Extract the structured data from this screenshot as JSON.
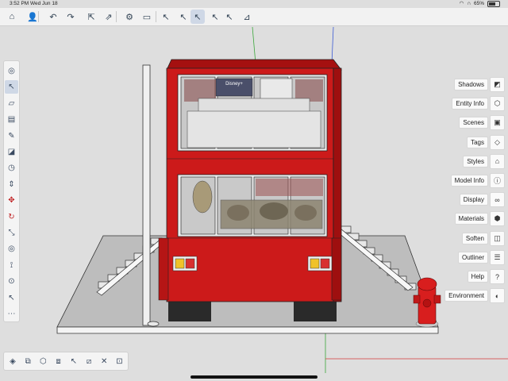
{
  "status": {
    "time": "3:52 PM",
    "date": "Wed Jun 18",
    "battery": "65%",
    "battery_level": 0.65
  },
  "toolbar": {
    "items": [
      {
        "name": "home-icon",
        "glyph": "⌂"
      },
      {
        "name": "account-icon",
        "glyph": "👤"
      },
      {
        "name": "undo-icon",
        "glyph": "↶"
      },
      {
        "name": "redo-icon",
        "glyph": "↷"
      },
      {
        "name": "import-icon",
        "glyph": "⇱"
      },
      {
        "name": "export-icon",
        "glyph": "⇗"
      },
      {
        "name": "settings-icon",
        "glyph": "⚙"
      },
      {
        "name": "view-icon",
        "glyph": "▭"
      },
      {
        "name": "select-plus-icon",
        "glyph": "↖"
      },
      {
        "name": "select-minus-icon",
        "glyph": "↖"
      },
      {
        "name": "select-icon",
        "glyph": "↖"
      },
      {
        "name": "select-toggle-icon",
        "glyph": "↖"
      },
      {
        "name": "select-visible-icon",
        "glyph": "↖"
      },
      {
        "name": "xray-icon",
        "glyph": "⊿"
      }
    ]
  },
  "left_tools": [
    {
      "name": "orbit-icon",
      "glyph": "◎"
    },
    {
      "name": "select-tool-icon",
      "glyph": "↖",
      "active": true
    },
    {
      "name": "eraser-icon",
      "glyph": "▱"
    },
    {
      "name": "paint-bucket-icon",
      "glyph": "▤"
    },
    {
      "name": "pencil-icon",
      "glyph": "✎"
    },
    {
      "name": "rectangle-icon",
      "glyph": "◪"
    },
    {
      "name": "circle-icon",
      "glyph": "◷"
    },
    {
      "name": "push-pull-icon",
      "glyph": "⇕"
    },
    {
      "name": "move-icon",
      "glyph": "✥",
      "red": true
    },
    {
      "name": "rotate-icon",
      "glyph": "↻",
      "red": true
    },
    {
      "name": "scale-icon",
      "glyph": "⤡"
    },
    {
      "name": "offset-icon",
      "glyph": "◎"
    },
    {
      "name": "tape-measure-icon",
      "glyph": "⟟"
    },
    {
      "name": "text-tool-icon",
      "glyph": "⊙"
    },
    {
      "name": "pointer-icon",
      "glyph": "↖"
    },
    {
      "name": "more-icon",
      "glyph": "⋯"
    }
  ],
  "bottom_tools": [
    {
      "name": "component-icon",
      "glyph": "◈"
    },
    {
      "name": "group-icon",
      "glyph": "⧉"
    },
    {
      "name": "solid-icon",
      "glyph": "⬡"
    },
    {
      "name": "section-icon",
      "glyph": "⧈"
    },
    {
      "name": "pick-icon",
      "glyph": "↖"
    },
    {
      "name": "follow-me-icon",
      "glyph": "⧄"
    },
    {
      "name": "intersect-icon",
      "glyph": "✕"
    },
    {
      "name": "edit-icon",
      "glyph": "⊡"
    }
  ],
  "panels": [
    {
      "label": "Shadows",
      "name": "panel-shadows",
      "icon": "shadows-icon",
      "glyph": "◩"
    },
    {
      "label": "Entity Info",
      "name": "panel-entity-info",
      "icon": "entity-info-icon",
      "glyph": "⬡"
    },
    {
      "label": "Scenes",
      "name": "panel-scenes",
      "icon": "scenes-icon",
      "glyph": "▣"
    },
    {
      "label": "Tags",
      "name": "panel-tags",
      "icon": "tags-icon",
      "glyph": "◇"
    },
    {
      "label": "Styles",
      "name": "panel-styles",
      "icon": "styles-icon",
      "glyph": "⌂"
    },
    {
      "label": "Model Info",
      "name": "panel-model-info",
      "icon": "model-info-icon",
      "glyph": "ⓘ"
    },
    {
      "label": "Display",
      "name": "panel-display",
      "icon": "display-icon",
      "glyph": "∞"
    },
    {
      "label": "Materials",
      "name": "panel-materials",
      "icon": "materials-icon",
      "glyph": "⬢"
    },
    {
      "label": "Soften",
      "name": "panel-soften",
      "icon": "soften-icon",
      "glyph": "◫"
    },
    {
      "label": "Outliner",
      "name": "panel-outliner",
      "icon": "outliner-icon",
      "glyph": "☰"
    },
    {
      "label": "Help",
      "name": "panel-help",
      "icon": "help-icon",
      "glyph": "?"
    },
    {
      "label": "Environment",
      "name": "panel-environment",
      "icon": "environment-icon",
      "glyph": "◐"
    }
  ],
  "scene": {
    "bus_color": "#cc1a1a",
    "tv_label": "Disney+",
    "hydrant_color": "#d81e1e",
    "axis_red": "#d43a3a",
    "axis_green": "#3aa83a",
    "axis_blue": "#3a5ad4"
  }
}
